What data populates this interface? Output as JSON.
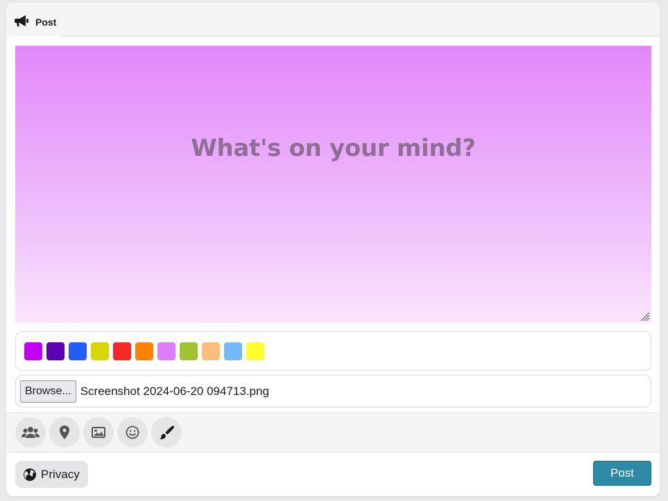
{
  "header": {
    "title": "Post",
    "icon": "megaphone-icon"
  },
  "composer": {
    "placeholder": "What's on your mind?",
    "gradient_top": "#e387fb",
    "gradient_bottom": "#fbe6fd",
    "text_color": "#8f6e96"
  },
  "swatches": [
    "#c000f6",
    "#5c00b4",
    "#235cf6",
    "#d8d800",
    "#f62727",
    "#ff8200",
    "#de7cfa",
    "#9fc42f",
    "#ffbd7b",
    "#74b9ff",
    "#ffff2d"
  ],
  "file_input": {
    "button_label": "Browse...",
    "file_name": "Screenshot 2024-06-20 094713.png"
  },
  "tools": [
    {
      "icon": "users-icon"
    },
    {
      "icon": "map-marker-icon"
    },
    {
      "icon": "image-icon"
    },
    {
      "icon": "smiley-icon"
    },
    {
      "icon": "paintbrush-icon"
    }
  ],
  "footer": {
    "privacy_label": "Privacy",
    "privacy_icon": "globe-icon",
    "post_label": "Post",
    "post_color": "#2c8aa6"
  }
}
